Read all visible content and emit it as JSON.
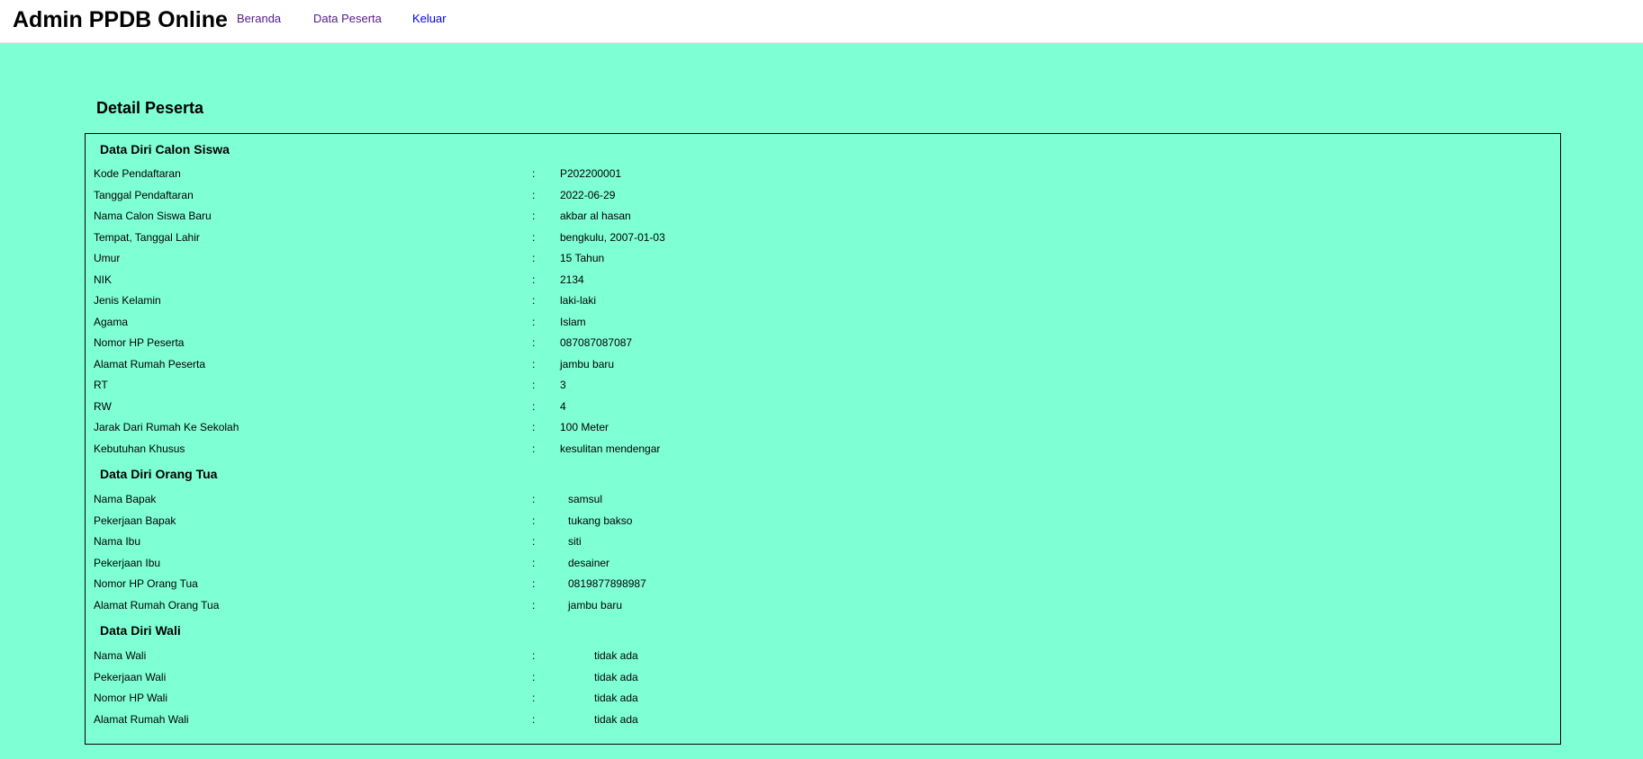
{
  "navbar": {
    "brand": "Admin PPDB Online",
    "links": [
      {
        "label": "Beranda"
      },
      {
        "label": "Data Peserta"
      },
      {
        "label": "Keluar"
      }
    ]
  },
  "page_title": "Detail Peserta",
  "separator": ":",
  "sections": {
    "siswa": {
      "title": "Data Diri Calon Siswa",
      "rows": [
        {
          "label": "Kode Pendaftaran",
          "value": "P202200001"
        },
        {
          "label": "Tanggal Pendaftaran",
          "value": "2022-06-29"
        },
        {
          "label": "Nama Calon Siswa Baru",
          "value": "akbar al hasan"
        },
        {
          "label": "Tempat, Tanggal Lahir",
          "value": "bengkulu, 2007-01-03"
        },
        {
          "label": "Umur",
          "value": "15 Tahun"
        },
        {
          "label": "NIK",
          "value": "2134"
        },
        {
          "label": "Jenis Kelamin",
          "value": "laki-laki"
        },
        {
          "label": "Agama",
          "value": "Islam"
        },
        {
          "label": "Nomor HP Peserta",
          "value": "087087087087"
        },
        {
          "label": "Alamat Rumah Peserta",
          "value": "jambu baru"
        },
        {
          "label": "RT",
          "value": "3"
        },
        {
          "label": "RW",
          "value": "4"
        },
        {
          "label": "Jarak Dari Rumah Ke Sekolah",
          "value": "100 Meter"
        },
        {
          "label": "Kebutuhan Khusus",
          "value": "kesulitan mendengar"
        }
      ]
    },
    "orang_tua": {
      "title": "Data Diri Orang Tua",
      "rows": [
        {
          "label": "Nama Bapak",
          "value": "samsul"
        },
        {
          "label": "Pekerjaan Bapak",
          "value": "tukang bakso"
        },
        {
          "label": "Nama Ibu",
          "value": "siti"
        },
        {
          "label": "Pekerjaan Ibu",
          "value": "desainer"
        },
        {
          "label": "Nomor HP Orang Tua",
          "value": "0819877898987"
        },
        {
          "label": "Alamat Rumah Orang Tua",
          "value": "jambu baru"
        }
      ]
    },
    "wali": {
      "title": "Data Diri Wali",
      "rows": [
        {
          "label": "Nama Wali",
          "value": "tidak ada"
        },
        {
          "label": "Pekerjaan Wali",
          "value": "tidak ada"
        },
        {
          "label": "Nomor HP Wali",
          "value": "tidak ada"
        },
        {
          "label": "Alamat Rumah Wali",
          "value": "tidak ada"
        }
      ]
    }
  }
}
